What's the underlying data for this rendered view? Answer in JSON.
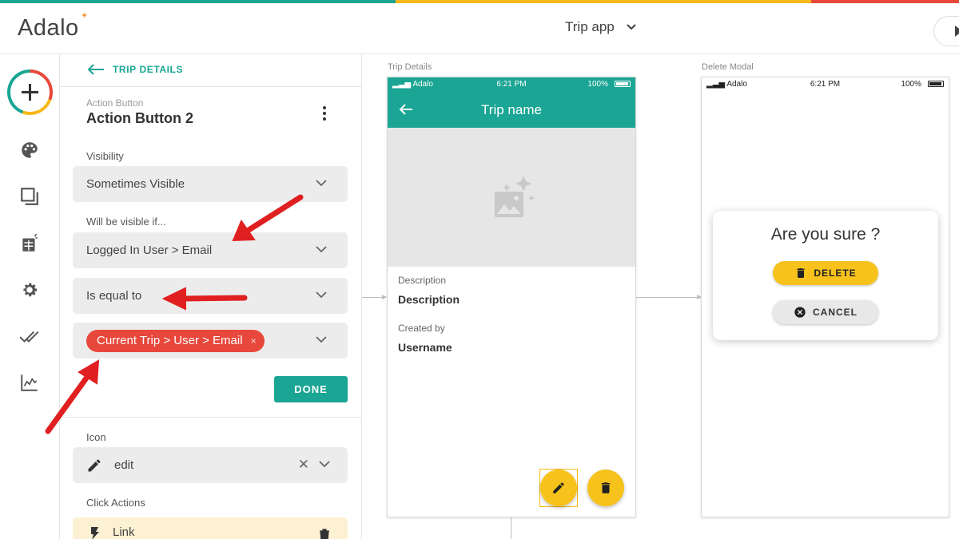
{
  "brand": {
    "logo_text": "Adalo",
    "colors": {
      "teal": "#1aa594",
      "yellow": "#f7b718",
      "red": "#e8473c",
      "annotation": "#e02020"
    }
  },
  "header": {
    "app_name": "Trip app",
    "dropdown_icon": "chevron-down-icon",
    "preview_icon": "play-icon"
  },
  "rail": {
    "items": [
      "add-icon",
      "palette-icon",
      "screens-icon",
      "database-icon",
      "gear-icon",
      "checkmarks-icon",
      "analytics-icon"
    ]
  },
  "panel": {
    "back_label": "TRIP DETAILS",
    "component_type": "Action Button",
    "component_name": "Action Button 2",
    "visibility_label": "Visibility",
    "visibility_value": "Sometimes Visible",
    "condition_label": "Will be visible if...",
    "condition_left": "Logged In User > Email",
    "condition_operator": "Is equal to",
    "condition_right": "Current Trip > User > Email",
    "done_label": "DONE",
    "icon_label": "Icon",
    "icon_value": "edit",
    "click_actions_label": "Click Actions",
    "action_item": "Link"
  },
  "canvas": {
    "screen1": {
      "label": "Trip Details",
      "status": {
        "carrier": "Adalo",
        "time": "6:21 PM",
        "battery": "100%"
      },
      "title": "Trip name",
      "desc_label": "Description",
      "desc_value": "Description",
      "created_label": "Created by",
      "created_value": "Username"
    },
    "screen2": {
      "label": "Delete Modal",
      "status": {
        "carrier": "Adalo",
        "time": "6:21 PM",
        "battery": "100%"
      },
      "question": "Are you sure ?",
      "delete_label": "DELETE",
      "cancel_label": "CANCEL"
    }
  }
}
